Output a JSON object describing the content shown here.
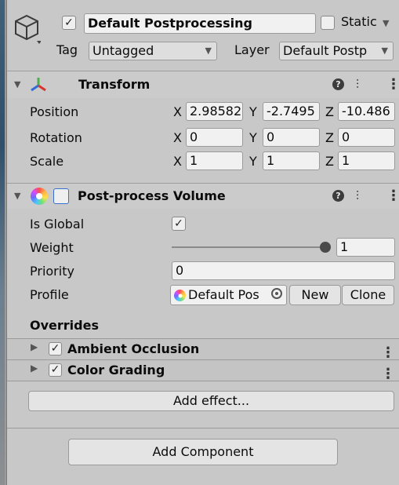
{
  "object": {
    "active": true,
    "name": "Default Postprocessing",
    "static_label": "Static",
    "tag_label": "Tag",
    "tag_value": "Untagged",
    "layer_label": "Layer",
    "layer_value": "Default Postp"
  },
  "transform": {
    "title": "Transform",
    "rows": [
      {
        "label": "Position",
        "x": "2.98582",
        "y": "-2.7495",
        "z": "-10.486"
      },
      {
        "label": "Rotation",
        "x": "0",
        "y": "0",
        "z": "0"
      },
      {
        "label": "Scale",
        "x": "1",
        "y": "1",
        "z": "1"
      }
    ],
    "axis_x": "X",
    "axis_y": "Y",
    "axis_z": "Z"
  },
  "volume": {
    "title": "Post-process Volume",
    "is_global_label": "Is Global",
    "is_global": true,
    "weight_label": "Weight",
    "weight_value": "1",
    "weight_fraction": 1.0,
    "priority_label": "Priority",
    "priority_value": "0",
    "profile_label": "Profile",
    "profile_value": "Default Pos",
    "new_label": "New",
    "clone_label": "Clone",
    "overrides_label": "Overrides",
    "effects": [
      {
        "name": "Ambient Occlusion",
        "enabled": true
      },
      {
        "name": "Color Grading",
        "enabled": true
      }
    ],
    "add_effect_label": "Add effect..."
  },
  "add_component_label": "Add Component",
  "colors": {
    "panel": "#c8c8c8",
    "header": "#cbcbcb",
    "field": "#f1f1f1"
  }
}
